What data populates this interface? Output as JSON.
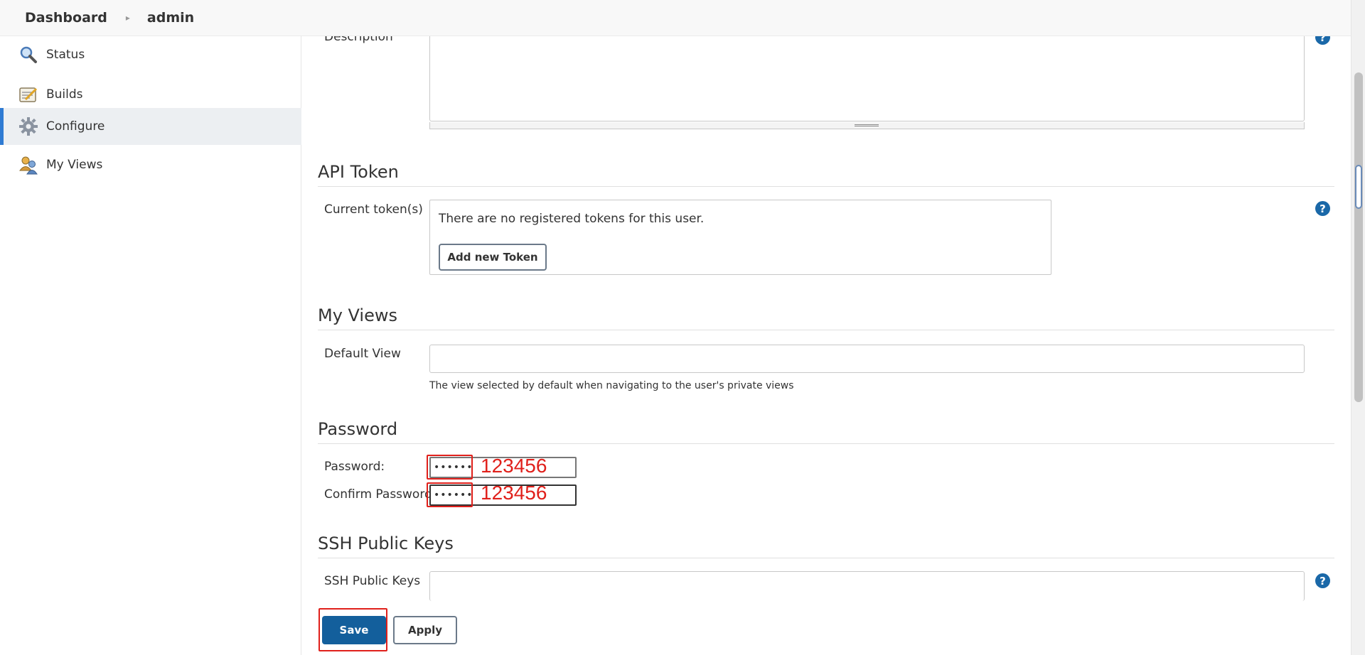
{
  "header": {
    "breadcrumb": [
      "Dashboard",
      "admin"
    ]
  },
  "sidebar": {
    "items": [
      {
        "label": "Status",
        "icon": "search-icon"
      },
      {
        "label": "Builds",
        "icon": "notepad-icon"
      },
      {
        "label": "Configure",
        "icon": "gear-icon",
        "active": true
      },
      {
        "label": "My Views",
        "icon": "users-icon"
      }
    ]
  },
  "description": {
    "label": "Description",
    "value": ""
  },
  "api_token": {
    "title": "API Token",
    "label": "Current token(s)",
    "empty_text": "There are no registered tokens for this user.",
    "add_button": "Add new Token"
  },
  "my_views": {
    "title": "My Views",
    "label": "Default View",
    "value": "",
    "hint": "The view selected by default when navigating to the user's private views"
  },
  "password": {
    "title": "Password",
    "password_label": "Password:",
    "confirm_label": "Confirm Password:",
    "password_value": "••••••",
    "confirm_value": "••••••",
    "annotation_1": "123456",
    "annotation_2": "123456"
  },
  "ssh": {
    "title": "SSH Public Keys",
    "label": "SSH Public Keys",
    "value": ""
  },
  "actions": {
    "save": "Save",
    "apply": "Apply"
  },
  "help_icon": "?",
  "colors": {
    "accent": "#135f9c",
    "annotation": "#e0201b",
    "active_bar": "#2f7bd3"
  }
}
